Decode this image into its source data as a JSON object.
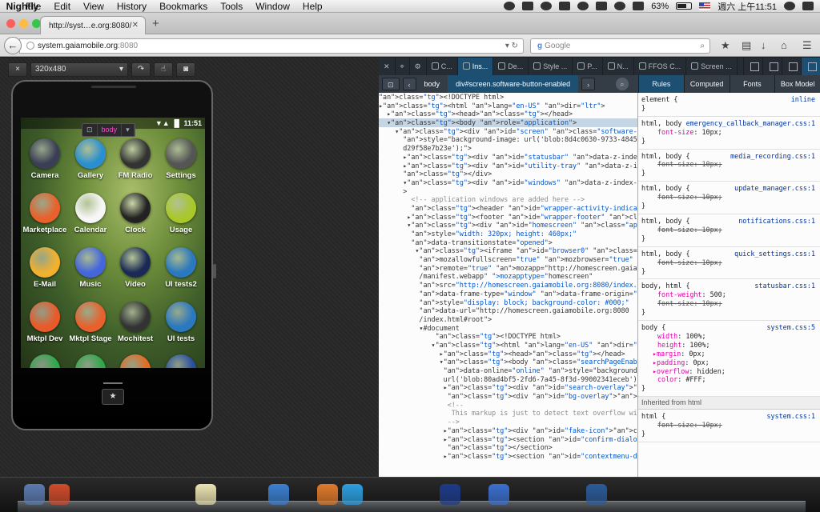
{
  "menubar": {
    "app": "Nightly",
    "menus": [
      "File",
      "Edit",
      "View",
      "History",
      "Bookmarks",
      "Tools",
      "Window",
      "Help"
    ],
    "battery": "63%",
    "clock": "週六 上午11:51"
  },
  "browser": {
    "tab_title": "http://syst…e.org:8080/",
    "url_host": "system.gaiamobile.org",
    "url_port": ":8080",
    "search_placeholder": "Google"
  },
  "rdm": {
    "size": "320x480",
    "close": "×"
  },
  "phone": {
    "time": "11:51",
    "overlay_tag": "body",
    "apps": [
      {
        "label": "Camera",
        "color": "#3b3f55"
      },
      {
        "label": "Gallery",
        "color": "#2a8fd0"
      },
      {
        "label": "FM Radio",
        "color": "#333"
      },
      {
        "label": "Settings",
        "color": "#555"
      },
      {
        "label": "Marketplace",
        "color": "#e8612c"
      },
      {
        "label": "Calendar",
        "color": "#f6f6f6"
      },
      {
        "label": "Clock",
        "color": "#222"
      },
      {
        "label": "Usage",
        "color": "#a8c82a"
      },
      {
        "label": "E-Mail",
        "color": "#f0b030"
      },
      {
        "label": "Music",
        "color": "#4466dd"
      },
      {
        "label": "Video",
        "color": "#1b2a55"
      },
      {
        "label": "UI tests2",
        "color": "#2a78c0"
      },
      {
        "label": "Mktpl Dev",
        "color": "#e85a2a"
      },
      {
        "label": "Mktpl Stage",
        "color": "#e8612c"
      },
      {
        "label": "Mochitest",
        "color": "#333"
      },
      {
        "label": "UI tests",
        "color": "#2a78c0"
      },
      {
        "label": "",
        "color": "#2ea84a"
      },
      {
        "label": "",
        "color": "#2ea84a"
      },
      {
        "label": "",
        "color": "#e86a20"
      },
      {
        "label": "",
        "color": "#2850a0"
      }
    ]
  },
  "devtools": {
    "tabs": [
      "C...",
      "Ins...",
      "De...",
      "Style ...",
      "P...",
      "N...",
      "FFOS C...",
      "Screen ..."
    ],
    "breadcrumbs": [
      "body",
      "div#screen.software-button-enabled"
    ],
    "rules_tabs": [
      "Rules",
      "Computed",
      "Fonts",
      "Box Model"
    ],
    "markup": [
      "<!DOCTYPE html>",
      "▸<html lang=\"en-US\" dir=\"ltr\">",
      "  ▸<head></head>",
      "  ▾<body role=\"application\">",
      "    ▾<div id=\"screen\" class=\"software-button-enabled\"",
      "      style=\"background-image: url('blob:8d4c0630-9733-4845-8e47-",
      "      d29f58e7b23e');\">",
      "      ▸<div id=\"statusbar\" data-z-index-level=\"statusbar\"></div>",
      "      ▸<div id=\"utility-tray\" data-z-index-level=\"utility-tray\"",
      "      </div>",
      "      ▾<div id=\"windows\" data-z-index-level=\"app\" aria-hidden=\"false\"",
      "      >",
      "        <!-- application windows are added here -->",
      "        <header id=\"wrapper-activity-indicator\"></header>",
      "       ▸<footer id=\"wrapper-footer\" class=\"closed\"></footer>",
      "       ▾<div id=\"homescreen\" class=\"appWindow homescreen active\"",
      "        style=\"width: 320px; height: 460px;\"",
      "        data-transitionstate=\"opened\">",
      "         ▾<iframe id=\"browser0\" class=\"browser\"",
      "          mozallowfullscreen=\"true\" mozbrowser=\"true\" name=\"main\"",
      "          remote=\"true\" mozapp=\"http://homescreen.gaiamobile.org:8080",
      "          /manifest.webapp\" mozapptype=\"homescreen\"",
      "          src=\"http://homescreen.gaiamobile.org:8080/index.html#root\"",
      "          data-frame-type=\"window\" data-frame-origin=\"homescreen\"",
      "          style=\"display: block; background-color: #000;\"",
      "          data-url=\"http://homescreen.gaiamobile.org:8080",
      "          /index.html#root\">",
      "          ▾#document",
      "              <!DOCTYPE html>",
      "             ▾<html lang=\"en-US\" dir=\"ltr\">",
      "               ▸<head></head>",
      "               ▾<body class=\"searchPageEnabled\" data-mode=\"normal\"",
      "                data-online=\"online\" style=\"background-image:",
      "                url('blob:80ad4bf5-2fd6-7a45-8f3d-99002341eceb');\">",
      "                ▸<div id=\"search-overlay\"></div>",
      "                 <div id=\"bg-overlay\"></div>",
      "                 <!--",
      "                  This markup is just to detect text overflow with …",
      "                 -->",
      "                ▸<div id=\"fake-icon\"></div>",
      "                ▸<section id=\"confirm-dialog\" is=\"confirm-dialog\"",
      "                 </section>",
      "                ▸<section id=\"contextmenu-dialog\" is=\"contextmenu-"
    ],
    "rules": [
      {
        "selector": "element {",
        "source": "inline",
        "props": []
      },
      {
        "selector": "html, body",
        "source": "emergency_callback_manager.css:1",
        "props": [
          {
            "name": "font-size",
            "value": "10px",
            "strike": false
          }
        ]
      },
      {
        "selector": "html, body {",
        "source": "media_recording.css:1",
        "props": [
          {
            "name": "font-size",
            "value": "10px",
            "strike": true
          }
        ]
      },
      {
        "selector": "html, body {",
        "source": "update_manager.css:1",
        "props": [
          {
            "name": "font-size",
            "value": "10px",
            "strike": true
          }
        ]
      },
      {
        "selector": "html, body {",
        "source": "notifications.css:1",
        "props": [
          {
            "name": "font-size",
            "value": "10px",
            "strike": true
          }
        ]
      },
      {
        "selector": "html, body {",
        "source": "quick_settings.css:1",
        "props": [
          {
            "name": "font-size",
            "value": "10px",
            "strike": true
          }
        ]
      },
      {
        "selector": "body, html {",
        "source": "statusbar.css:1",
        "props": [
          {
            "name": "font-weight",
            "value": "500",
            "strike": false
          },
          {
            "name": "font-size",
            "value": "10px",
            "strike": true
          }
        ]
      },
      {
        "selector": "body {",
        "source": "system.css:5",
        "props": [
          {
            "name": "width",
            "value": "100%",
            "strike": false
          },
          {
            "name": "height",
            "value": "100%",
            "strike": false
          },
          {
            "name": "▸margin",
            "value": "0px",
            "strike": false
          },
          {
            "name": "▸padding",
            "value": "0px",
            "strike": false
          },
          {
            "name": "▸overflow",
            "value": "hidden",
            "strike": false
          },
          {
            "name": "color",
            "value": "#FFF",
            "strike": false
          }
        ]
      }
    ],
    "inherited_label": "Inherited from html",
    "inherited_rule": {
      "selector": "html {",
      "source": "system.css:1",
      "props": [
        {
          "name": "font-size",
          "value": "10px",
          "strike": true
        }
      ]
    }
  }
}
